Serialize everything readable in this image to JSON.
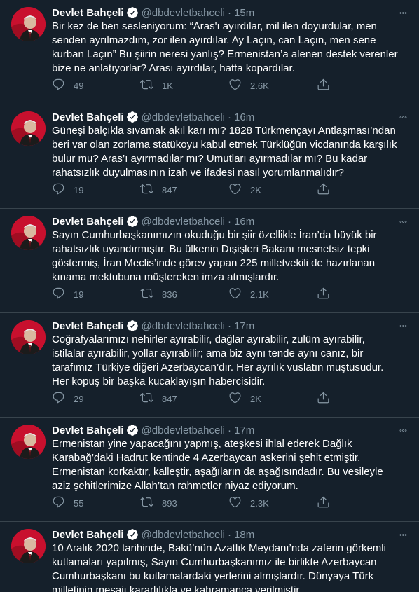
{
  "tweets": [
    {
      "name": "Devlet Bahçeli",
      "handle": "@dbdevletbahceli",
      "time": "15m",
      "text": "Bir kez de ben sesleniyorum: “Aras'ı ayırdılar, mil ilen doyurdular, men senden ayrılmazdım, zor ilen ayırdılar. Ay Laçın, can Laçın, men sene kurban Laçın” Bu şiirin neresi yanlış? Ermenistan’a alenen destek verenler bize ne anlatıyorlar? Arası ayırdılar, hatta kopardılar.",
      "replies": "49",
      "retweets": "1K",
      "likes": "2.6K"
    },
    {
      "name": "Devlet Bahçeli",
      "handle": "@dbdevletbahceli",
      "time": "16m",
      "text": "Güneşi balçıkla sıvamak akıl karı mı? 1828 Türkmençayı Antlaşması’ndan beri var olan zorlama statükoyu kabul etmek Türklüğün vicdanında karşılık bulur mu? Aras’ı ayırmadılar mı? Umutları ayırmadılar mı? Bu kadar rahatsızlık duyulmasının izah ve ifadesi nasıl yorumlanmalıdır?",
      "replies": "19",
      "retweets": "847",
      "likes": "2K"
    },
    {
      "name": "Devlet Bahçeli",
      "handle": "@dbdevletbahceli",
      "time": "16m",
      "text": "Sayın Cumhurbaşkanımızın okuduğu bir şiir özellikle İran’da büyük bir rahatsızlık uyandırmıştır. Bu ülkenin Dışişleri Bakanı mesnetsiz tepki göstermiş, İran Meclis’inde görev yapan 225 milletvekili de hazırlanan kınama mektubuna müştereken imza atmışlardır.",
      "replies": "19",
      "retweets": "836",
      "likes": "2.1K"
    },
    {
      "name": "Devlet Bahçeli",
      "handle": "@dbdevletbahceli",
      "time": "17m",
      "text": "Coğrafyalarımızı nehirler ayırabilir, dağlar ayırabilir, zulüm ayırabilir, istilalar ayırabilir, yollar ayırabilir; ama biz aynı tende aynı canız, bir tarafımız Türkiye diğeri Azerbaycan’dır. Her ayrılık vuslatın muştusudur. Her kopuş bir başka kucaklayışın habercisidir.",
      "replies": "29",
      "retweets": "847",
      "likes": "2K"
    },
    {
      "name": "Devlet Bahçeli",
      "handle": "@dbdevletbahceli",
      "time": "17m",
      "text": "Ermenistan yine yapacağını yapmış, ateşkesi ihlal ederek Dağlık Karabağ’daki Hadrut kentinde 4 Azerbaycan askerini şehit etmiştir. Ermenistan korkaktır, kalleştir, aşağıların da aşağısındadır. Bu vesileyle aziz şehitlerimize Allah’tan rahmetler niyaz ediyorum.",
      "replies": "55",
      "retweets": "893",
      "likes": "2.3K"
    },
    {
      "name": "Devlet Bahçeli",
      "handle": "@dbdevletbahceli",
      "time": "18m",
      "text": "10 Aralık 2020 tarihinde, Bakü’nün Azatlık Meydanı’nda zaferin görkemli kutlamaları yapılmış, Sayın Cumhurbaşkanımız ile birlikte Azerbaycan Cumhurbaşkanı bu kutlamalardaki yerlerini almışlardır. Dünyaya Türk milletinin mesajı kararlılıkla ve kahramanca verilmiştir.",
      "replies": "",
      "retweets": "",
      "likes": ""
    }
  ],
  "icons": {
    "verified": "verified-badge-icon",
    "more": "more-icon",
    "reply": "reply-icon",
    "retweet": "retweet-icon",
    "like": "like-icon",
    "share": "share-icon"
  },
  "colors": {
    "background": "#15202b",
    "divider": "#38444d",
    "secondary_text": "#8899a6",
    "verified": "#ffffff",
    "avatar_bg": "#b90f1f"
  }
}
